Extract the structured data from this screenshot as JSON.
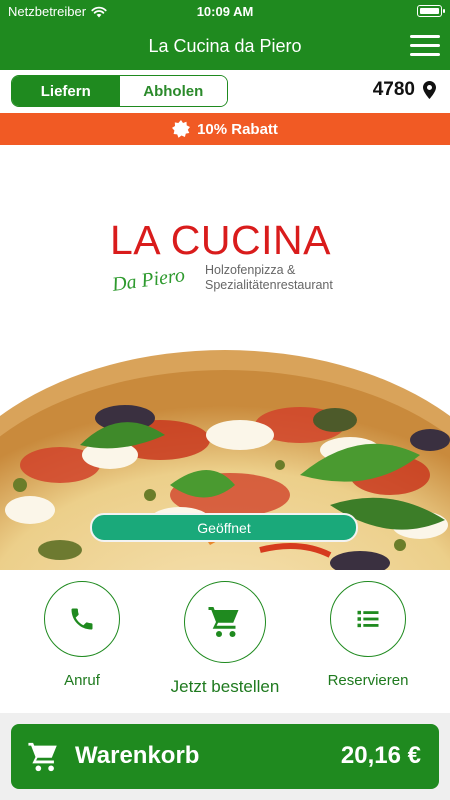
{
  "status_bar": {
    "carrier": "Netzbetreiber",
    "time": "10:09 AM"
  },
  "nav": {
    "title": "La Cucina da Piero"
  },
  "order_mode": {
    "deliver_label": "Liefern",
    "pickup_label": "Abholen",
    "selected": "deliver",
    "postal_code": "4780"
  },
  "banner": {
    "discount": "10% Rabatt"
  },
  "logo": {
    "main": "LA CUCINA",
    "script": "Da Piero",
    "subtitle_line1": "Holzofenpizza &",
    "subtitle_line2": "Spezialitätenrestaurant"
  },
  "hero": {
    "status_label": "Geöffnet"
  },
  "actions": [
    {
      "label": "Anruf",
      "icon": "phone-icon"
    },
    {
      "label": "Jetzt bestellen",
      "icon": "cart-icon"
    },
    {
      "label": "Reservieren",
      "icon": "list-icon"
    }
  ],
  "cart": {
    "label": "Warenkorb",
    "total": "20,16 €"
  },
  "colors": {
    "brand_green": "#1f8a1f",
    "discount_orange": "#f15a24",
    "open_teal": "#1aa97a",
    "logo_red": "#d91c1c"
  }
}
